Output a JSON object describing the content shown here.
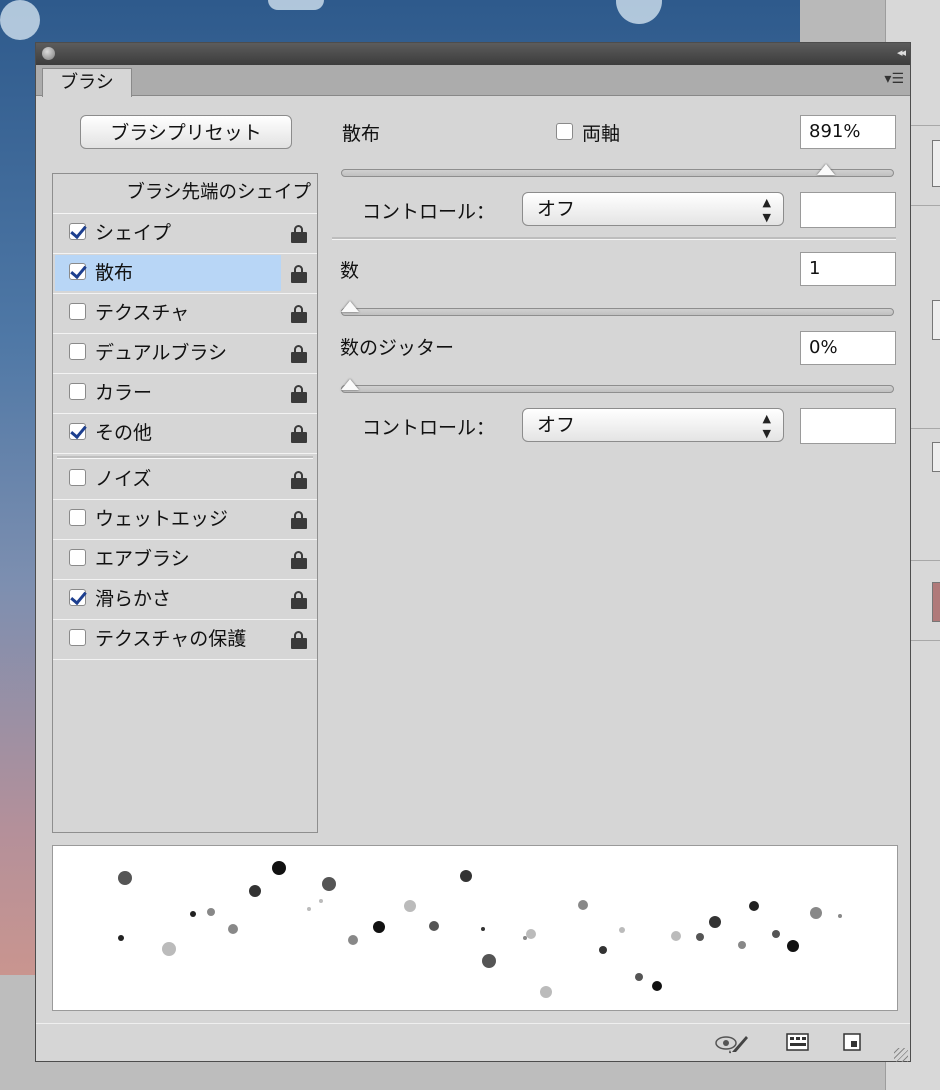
{
  "panel": {
    "tab_label": "ブラシ",
    "preset_button": "ブラシプリセット",
    "list_header": "ブラシ先端のシェイプ",
    "items": [
      {
        "label": "シェイプ",
        "checked": true,
        "selected": false
      },
      {
        "label": "散布",
        "checked": true,
        "selected": true
      },
      {
        "label": "テクスチャ",
        "checked": false,
        "selected": false
      },
      {
        "label": "デュアルブラシ",
        "checked": false,
        "selected": false
      },
      {
        "label": "カラー",
        "checked": false,
        "selected": false
      },
      {
        "label": "その他",
        "checked": true,
        "selected": false
      },
      {
        "label": "ノイズ",
        "checked": false,
        "selected": false
      },
      {
        "label": "ウェットエッジ",
        "checked": false,
        "selected": false
      },
      {
        "label": "エアブラシ",
        "checked": false,
        "selected": false
      },
      {
        "label": "滑らかさ",
        "checked": true,
        "selected": false
      },
      {
        "label": "テクスチャの保護",
        "checked": false,
        "selected": false
      }
    ]
  },
  "scatter": {
    "label": "散布",
    "both_axes_label": "両軸",
    "both_axes_checked": false,
    "value": "891%",
    "slider_fraction": 0.89,
    "control_label": "コントロール：",
    "control_value": "オフ"
  },
  "count": {
    "label": "数",
    "value": "1",
    "slider_fraction": 0.0
  },
  "count_jitter": {
    "label": "数のジッター",
    "value": "0%",
    "slider_fraction": 0.0,
    "control_label": "コントロール：",
    "control_value": "オフ"
  },
  "footer_icons": [
    "eye-brush-icon",
    "brush-grid-icon",
    "new-preset-icon"
  ],
  "colors": {
    "selection": "#b8d6f6",
    "checkmark": "#1d3f8f"
  }
}
